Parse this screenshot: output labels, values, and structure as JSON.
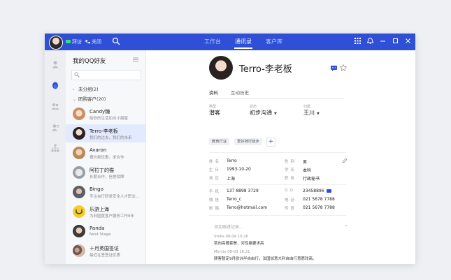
{
  "topbar": {
    "call_label": "拜访",
    "phone_label": "关闭",
    "tabs": [
      "工作台",
      "通讯录",
      "客户库"
    ],
    "active_tab": 1
  },
  "contacts": {
    "title": "我的QQ好友",
    "search_placeholder": "",
    "groups": [
      {
        "label": "未分组(2)",
        "chev": "›"
      },
      {
        "label": "团购客户(20)",
        "chev": "⌄"
      }
    ],
    "items": [
      {
        "name": "Candy糖",
        "sub": "给你的生活加点小甜蜜",
        "color": "#f0c8a8"
      },
      {
        "name": "Terro-李老板",
        "sub": "我们的过去，我们的未来",
        "color": "#3a2d2a"
      },
      {
        "name": "Avaron",
        "sub": "报价新优惠，求合作",
        "color": "#c9a47a"
      },
      {
        "name": "阿拉丁的猫",
        "sub": "长期合作，信誉保障",
        "color": "#9aa0a8"
      },
      {
        "name": "Bingo",
        "sub": "专注自行研发安全人才职业...",
        "color": "#5a5f66"
      },
      {
        "name": "乐游上海",
        "sub": "为旧国度客户服务工作8年",
        "color": "#f5cd2b"
      },
      {
        "name": "Panda",
        "sub": "Next Stage",
        "color": "#4a4a4a"
      },
      {
        "name": "十月英国签证",
        "sub": "最近在签签证优惠",
        "color": "#b07d6a"
      }
    ]
  },
  "profile": {
    "name": "Terro-李老板",
    "tabs": [
      "资料",
      "互动历史"
    ],
    "type_label": "类型",
    "type_value": "潜客",
    "status_label": "状态",
    "status_value": "初步沟通",
    "owner_label": "归属",
    "owner_value": "王川",
    "tags": [
      "教育行业",
      "爱好骑行徒步"
    ],
    "add_tag": "+",
    "fields_left": [
      {
        "label": "姓名",
        "value": "Terro"
      },
      {
        "label": "生日",
        "value": "1993-10-20"
      },
      {
        "label": "地区",
        "value": "上海"
      },
      {
        "label": "手机",
        "value": "137 8898 3729"
      },
      {
        "label": "微信",
        "value": "Terro_c"
      },
      {
        "label": "邮箱",
        "value": "Terro@hotmail.com"
      }
    ],
    "fields_right": [
      {
        "label": "性别",
        "value": "男"
      },
      {
        "label": "学历",
        "value": "本科"
      },
      {
        "label": "职务",
        "value": "行政秘书"
      },
      {
        "label": "QQ",
        "value": "23458896"
      },
      {
        "label": "电话",
        "value": "021 5678 7788"
      },
      {
        "label": "传真",
        "value": "021 5678 7788"
      }
    ],
    "follow_placeholder": "添加跟进记录...",
    "notes": [
      {
        "head": "Stella  08-04  10:26",
        "body": "锁向高著套餐，对性格要求高"
      },
      {
        "head": "Minnie  08-03  16:21",
        "body": "顾客暂定9月欧洲半自由行，法国加意大利自由行意愿较高。"
      }
    ]
  },
  "colors": {
    "accent": "#2f4fd6",
    "selected_row": "#e2eafd"
  }
}
